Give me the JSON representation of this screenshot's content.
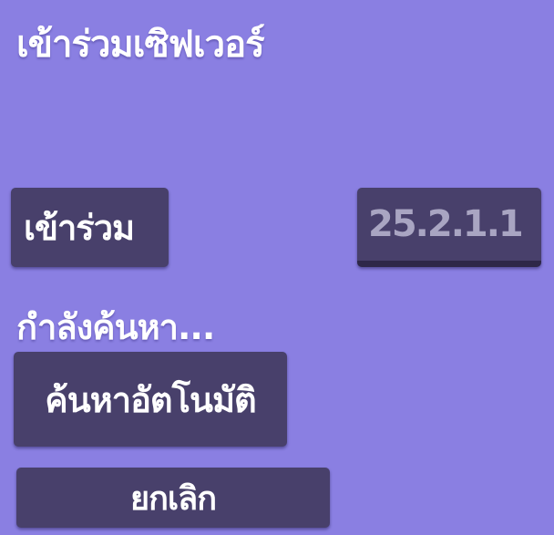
{
  "title": "เข้าร่วมเซิฟเวอร์",
  "join_button": {
    "label": "เข้าร่วม"
  },
  "ip_field": {
    "value": "25.2.1.1"
  },
  "status": {
    "text": "กำลังค้นหา..."
  },
  "auto_search_button": {
    "label": "ค้นหาอัตโนมัติ"
  },
  "cancel_button": {
    "label": "ยกเลิก"
  },
  "colors": {
    "background": "#8a7fe2",
    "button": "#48406b",
    "text": "#ffffff",
    "input_text": "#a9a5c2"
  }
}
